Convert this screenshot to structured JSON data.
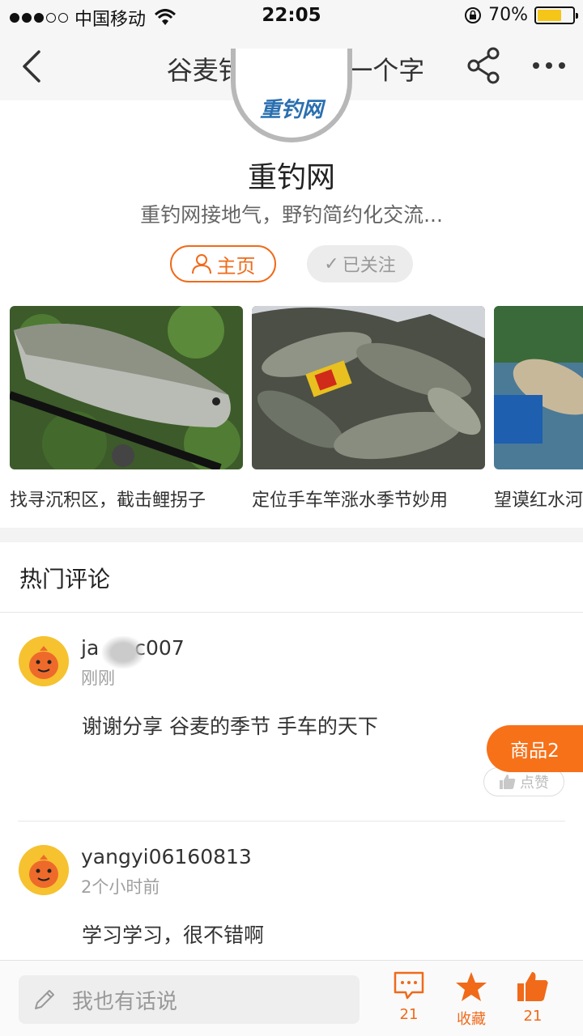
{
  "status_bar": {
    "carrier": "中国移动",
    "time": "22:05",
    "battery": "70%",
    "battery_level": 0.7,
    "signal_bars": 3
  },
  "nav": {
    "title": "谷麦钓不...略了一个字",
    "icons": [
      "back-arrow-icon",
      "share-icon",
      "more-icon"
    ]
  },
  "profile": {
    "logo_text": "重钓网",
    "name": "重钓网",
    "desc": "重钓网接地气，野钓简约化交流...",
    "home_label": "主页",
    "follow_label": "已关注"
  },
  "articles": [
    {
      "caption": "找寻沉积区，截击鲤拐子"
    },
    {
      "caption": "定位手车竿涨水季节妙用"
    },
    {
      "caption": "望谟红水河"
    }
  ],
  "hot_comments": {
    "title": "热门评论",
    "items": [
      {
        "user_prefix": "ja",
        "user_suffix": "c007",
        "time": "刚刚",
        "text": "谢谢分享 谷麦的季节 手车的天下",
        "like_label": "点赞"
      },
      {
        "user": "yangyi06160813",
        "time": "2个小时前",
        "text": "学习学习，很不错啊"
      }
    ]
  },
  "floating_tag": "商品2",
  "bottom_bar": {
    "placeholder": "我也有话说",
    "comment_count": "21",
    "collect_label": "收藏",
    "like_count": "21"
  },
  "colors": {
    "accent": "#f06a1a",
    "nav_bg": "#f6f6f6",
    "battery": "#f5c518"
  }
}
